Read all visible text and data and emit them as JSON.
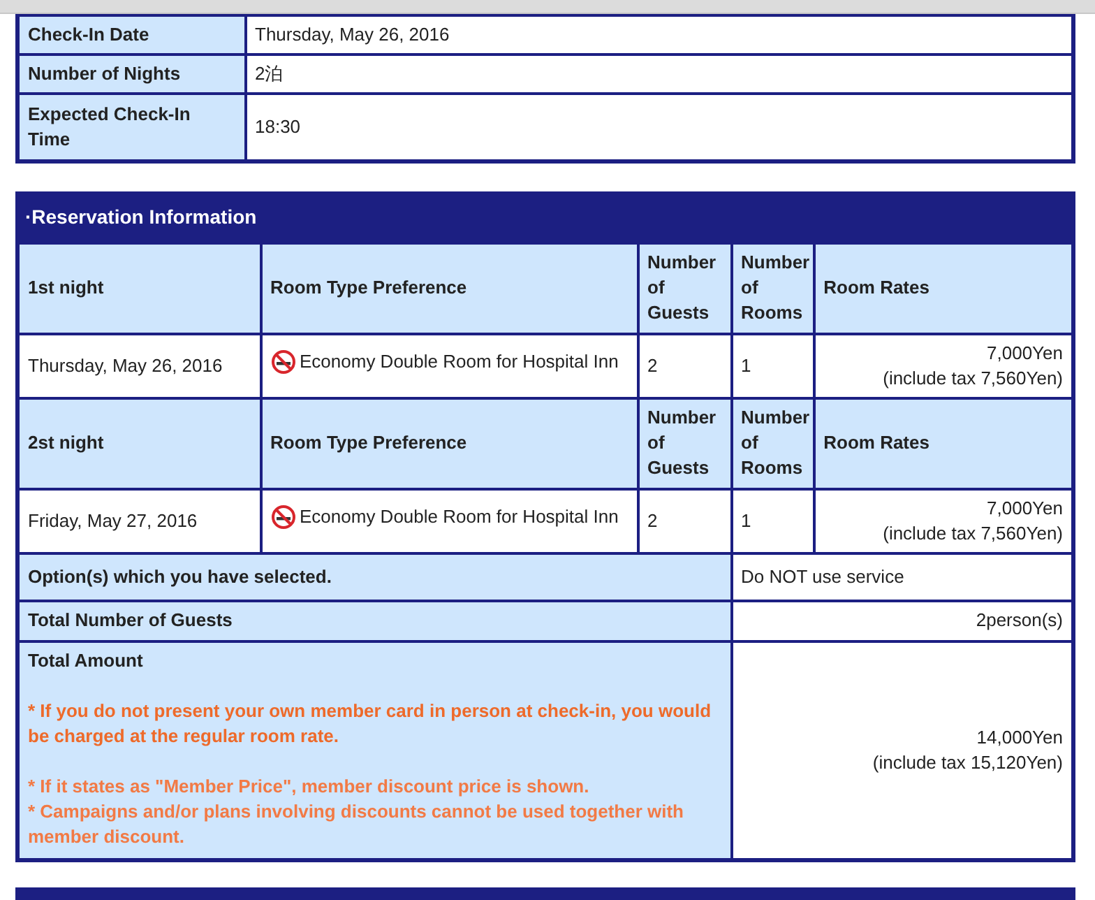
{
  "stay_details": [
    {
      "label": "Check-In Date",
      "value": "Thursday, May 26, 2016"
    },
    {
      "label": "Number of Nights",
      "value": "2泊"
    },
    {
      "label": "Expected Check-In Time",
      "value": "18:30"
    }
  ],
  "reservation": {
    "title": "·Reservation Information",
    "nights": [
      {
        "night": "1st night",
        "room_type_heading": "Room Type Preference",
        "guests_heading": "Number of Guests",
        "rooms_heading": "Number of Rooms",
        "rates_heading": "Room Rates",
        "date": "Thursday, May 26, 2016",
        "non_smoking": true,
        "room": "Economy Double Room for Hospital Inn",
        "guests": "2",
        "rooms": "1",
        "rate": "7,000Yen",
        "rate_tax": "(include tax 7,560Yen)"
      },
      {
        "night": "2st night",
        "room_type_heading": "Room Type Preference",
        "guests_heading": "Number of Guests",
        "rooms_heading": "Number of Rooms",
        "rates_heading": "Room Rates",
        "date": "Friday, May 27, 2016",
        "non_smoking": true,
        "room": "Economy Double Room for Hospital Inn",
        "guests": "2",
        "rooms": "1",
        "rate": "7,000Yen",
        "rate_tax": "(include tax 7,560Yen)"
      }
    ],
    "options": {
      "label": "Option(s) which you have selected.",
      "value": "Do NOT use service"
    },
    "total_guests": {
      "label": "Total Number of Guests",
      "value": "2person(s)"
    },
    "total_amount": {
      "label": "Total Amount",
      "notice": "* If you do not present your own member card in person at check-in, you would be charged at the regular room rate.",
      "notes": [
        "* If it states as \"Member Price\", member discount price is shown.",
        "* Campaigns and/or plans involving discounts cannot be used together with member discount."
      ],
      "amount": "14,000Yen",
      "amount_tax": "(include tax 15,120Yen)"
    }
  }
}
